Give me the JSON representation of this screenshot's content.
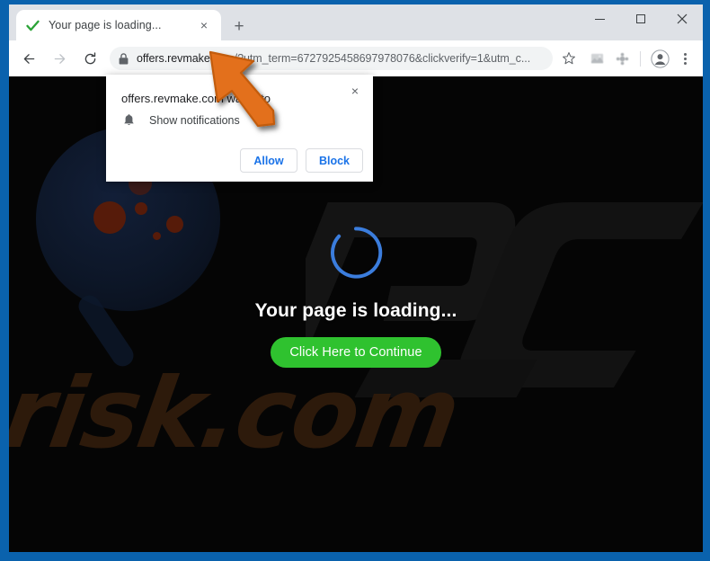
{
  "window": {
    "frame_color": "#0a62ad",
    "controls": {
      "minimize": "minimize-button",
      "maximize": "maximize-button",
      "close": "close-button"
    }
  },
  "tabstrip": {
    "active_tab": {
      "title": "Your page is loading...",
      "favicon": "green-check-icon",
      "close_label": "×"
    },
    "new_tab_label": "+"
  },
  "toolbar": {
    "back_icon": "back-arrow-icon",
    "forward_icon": "forward-arrow-icon",
    "reload_icon": "reload-icon",
    "lock_icon": "lock-icon",
    "url_domain": "offers.revmake.com",
    "url_rest": "/?utm_term=6727925458697978076&clickverify=1&utm_c...",
    "star_icon": "bookmark-star-icon",
    "extension_1_icon": "extension-icon",
    "extension_2_icon": "extension-icon",
    "avatar_icon": "profile-avatar-icon",
    "menu_icon": "three-dot-menu-icon"
  },
  "notification_popup": {
    "origin_text": "offers.revmake.com wants to",
    "permission_icon": "bell-icon",
    "permission_label": "Show notifications",
    "allow_label": "Allow",
    "block_label": "Block",
    "close_label": "×"
  },
  "page": {
    "background_color": "#050505",
    "spinner_color": "#3b7ddd",
    "heading": "Your page is loading...",
    "cta_label": "Click Here to Continue",
    "cta_color": "#2fc22f",
    "watermark_bottom": "risk.com",
    "watermark_top": "PC"
  },
  "annotation": {
    "cursor_icon": "orange-arrow-cursor",
    "cursor_color": "#e3701a"
  }
}
